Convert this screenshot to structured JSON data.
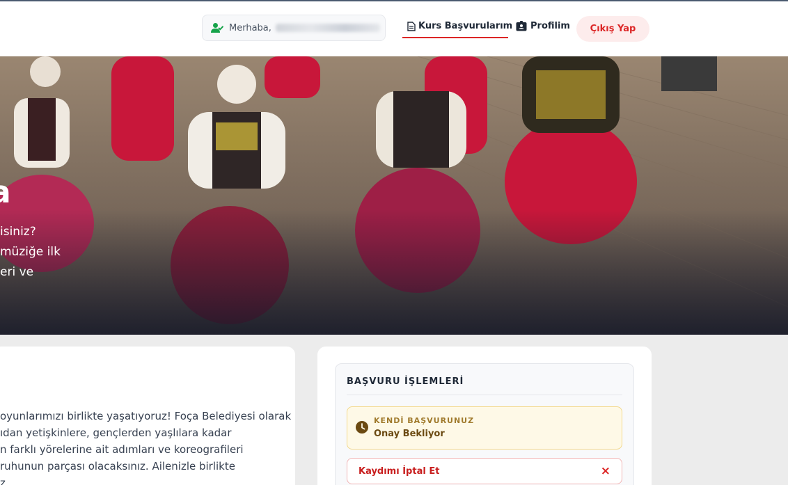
{
  "header": {
    "greeting": "Merhaba,",
    "nav": {
      "applications_label": "Kurs Başvurularım",
      "profile_label": "Profilim",
      "logout_label": "Çıkış Yap"
    }
  },
  "hero": {
    "title_fragment": "a",
    "lines": [
      "isiniz?",
      "müziğe ilk",
      "eri ve"
    ]
  },
  "about": {
    "lines": [
      "oyunlarımızı birlikte yaşatıyoruz! Foça Belediyesi olarak",
      "ıdan yetişkinlere, gençlerden yaşlılara kadar",
      "n farklı yörelerine ait adımları ve koreografileri",
      "ruhunun parçası olacaksınız. Ailenizle birlikte",
      "z"
    ]
  },
  "application_panel": {
    "title": "BAŞVURU İŞLEMLERİ",
    "status_label": "KENDİ BAŞVURUNUZ",
    "status_value": "Onay Bekliyor",
    "cancel_label": "Kaydımı İptal Et",
    "cancel_icon": "×"
  },
  "colors": {
    "accent_red": "#dc2626",
    "pending_bg": "#fef9e7",
    "pending_text": "#6b4a12",
    "user_icon_green": "#16a34a"
  },
  "icons": [
    "user-check-icon",
    "document-icon",
    "id-badge-icon",
    "clock-icon",
    "close-icon"
  ]
}
